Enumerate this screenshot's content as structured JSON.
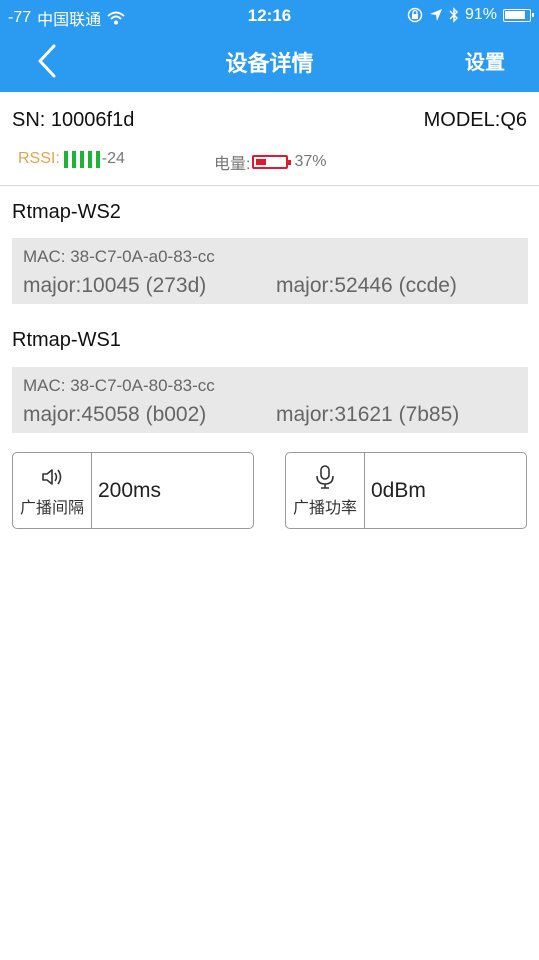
{
  "status_bar": {
    "signal": "-77",
    "carrier": "中国联通",
    "time": "12:16",
    "battery_percent": "91%",
    "battery_level": 0.91,
    "icons": [
      "wifi-icon",
      "orientation-lock-icon",
      "location-arrow-icon",
      "bluetooth-icon",
      "battery-icon"
    ]
  },
  "nav": {
    "title": "设备详情",
    "settings_label": "设置",
    "back_icon": "chevron-left-icon"
  },
  "device": {
    "sn": "SN: 10006f1d",
    "model": "MODEL:Q6",
    "rssi_label": "RSSI:",
    "rssi_bars": 5,
    "rssi_value": "-24",
    "battery_label": "电量:",
    "battery_percent": "37%",
    "battery_level": 0.37
  },
  "beacons": [
    {
      "name": "Rtmap-WS2",
      "mac": "MAC: 38-C7-0A-a0-83-cc",
      "major_1": "major:10045 (273d)",
      "major_2": "major:52446 (ccde)"
    },
    {
      "name": "Rtmap-WS1",
      "mac": "MAC: 38-C7-0A-80-83-cc",
      "major_1": "major:45058 (b002)",
      "major_2": "major:31621 (7b85)"
    }
  ],
  "controls": {
    "interval": {
      "icon": "speaker-icon",
      "caption": "广播间隔",
      "value": "200ms"
    },
    "power": {
      "icon": "microphone-icon",
      "caption": "广播功率",
      "value": "0dBm"
    }
  },
  "colors": {
    "header_bg": "#2a9bf0",
    "rssi_label": "#e5a44b",
    "rssi_bars": "#1cb435",
    "battery_low": "#e0192f",
    "card_bg": "#e8e8e8"
  }
}
